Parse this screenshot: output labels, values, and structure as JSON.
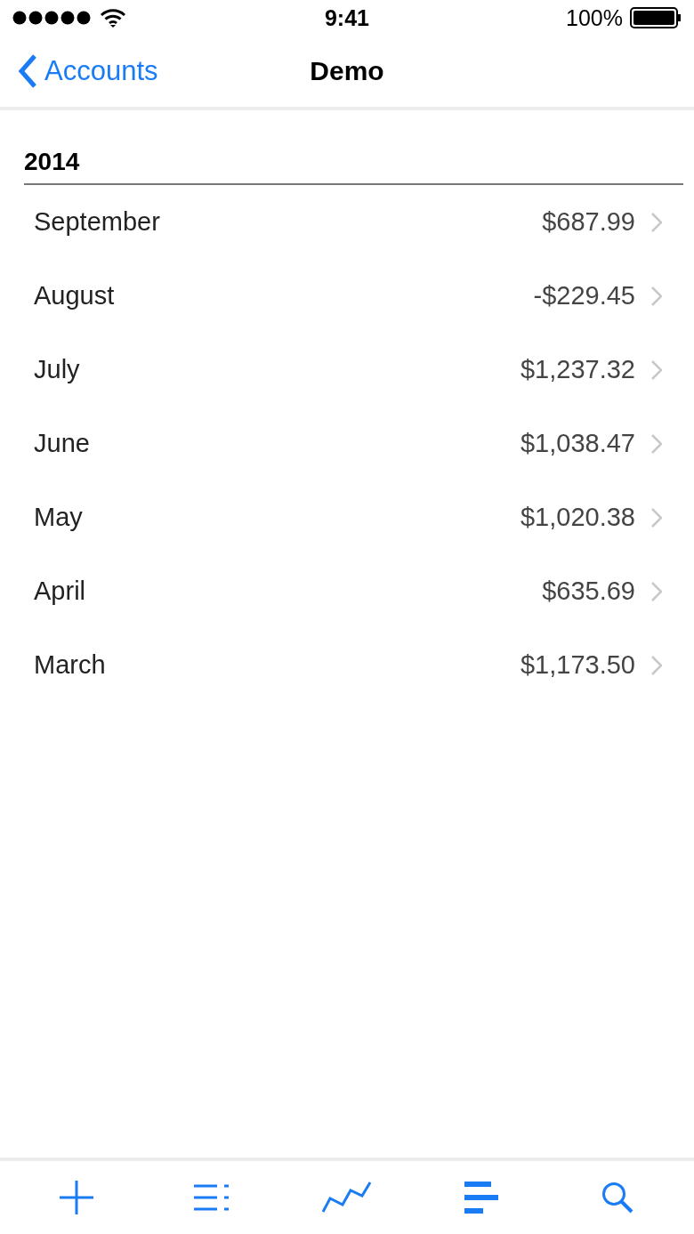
{
  "status_bar": {
    "time": "9:41",
    "battery": "100%"
  },
  "nav": {
    "back": "Accounts",
    "title": "Demo"
  },
  "section": {
    "title": "2014",
    "rows": [
      {
        "month": "September",
        "amount": "$687.99"
      },
      {
        "month": "August",
        "amount": "-$229.45"
      },
      {
        "month": "July",
        "amount": "$1,237.32"
      },
      {
        "month": "June",
        "amount": "$1,038.47"
      },
      {
        "month": "May",
        "amount": "$1,020.38"
      },
      {
        "month": "April",
        "amount": "$635.69"
      },
      {
        "month": "March",
        "amount": "$1,173.50"
      }
    ]
  },
  "tab_bar": [
    {
      "kind": "add"
    },
    {
      "kind": "list"
    },
    {
      "kind": "chart"
    },
    {
      "kind": "bars"
    },
    {
      "kind": "search"
    }
  ]
}
